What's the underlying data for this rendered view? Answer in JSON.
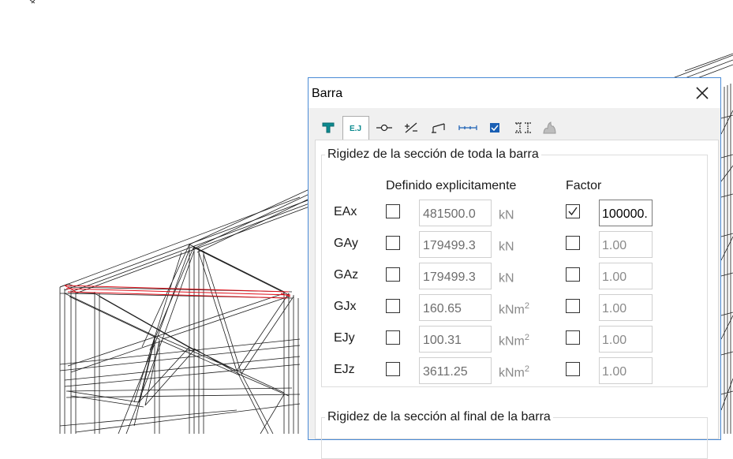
{
  "dialog": {
    "title": "Barra",
    "close_icon": "close-icon",
    "tabs": [
      {
        "icon": "section-icon"
      },
      {
        "icon": "stiffness-icon",
        "active": true
      },
      {
        "icon": "release-icon"
      },
      {
        "icon": "angle-icon"
      },
      {
        "icon": "offset-icon"
      },
      {
        "icon": "span-icon"
      },
      {
        "icon": "check-icon"
      },
      {
        "icon": "buckling-icon"
      },
      {
        "icon": "fire-icon"
      }
    ]
  },
  "group1": {
    "legend": "Rigidez de la sección de toda la barra",
    "col_defined": "Definido explicitamente",
    "col_factor": "Factor",
    "rows": [
      {
        "label": "EAx",
        "value": "481500.0",
        "unit": "kN",
        "unit_sup": "",
        "factor": "100000.",
        "defined_checked": false,
        "factor_checked": true
      },
      {
        "label": "GAy",
        "value": "179499.3",
        "unit": "kN",
        "unit_sup": "",
        "factor": "1.00",
        "defined_checked": false,
        "factor_checked": false
      },
      {
        "label": "GAz",
        "value": "179499.3",
        "unit": "kN",
        "unit_sup": "",
        "factor": "1.00",
        "defined_checked": false,
        "factor_checked": false
      },
      {
        "label": "GJx",
        "value": "160.65",
        "unit": "kNm",
        "unit_sup": "2",
        "factor": "1.00",
        "defined_checked": false,
        "factor_checked": false
      },
      {
        "label": "EJy",
        "value": "100.31",
        "unit": "kNm",
        "unit_sup": "2",
        "factor": "1.00",
        "defined_checked": false,
        "factor_checked": false
      },
      {
        "label": "EJz",
        "value": "3611.25",
        "unit": "kNm",
        "unit_sup": "2",
        "factor": "1.00",
        "defined_checked": false,
        "factor_checked": false
      }
    ]
  },
  "group2": {
    "legend": "Rigidez de la sección al final de la barra"
  },
  "colors": {
    "selected_member": "#e0101a",
    "wireframe": "#1c1c1c",
    "tab_icon": "#0c8a8f"
  }
}
